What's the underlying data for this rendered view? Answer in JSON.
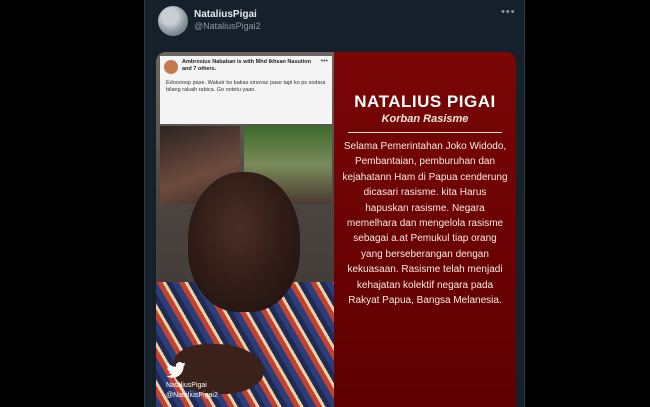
{
  "tweet": {
    "display_name": "NataliusPigai",
    "handle": "@NataliusPigai2",
    "more_icon": "more-dots-icon"
  },
  "media": {
    "fb_post": {
      "author_line": "Ambrosius Nababan is with Mhd Ikhsan Nasution and 7 others.",
      "body": "Edooooop pase. Wakatr ko bakas sinovac pase tapi ko ps sodara bilang rakaih rabica. Go ootetu yaan."
    },
    "watermark": {
      "icon": "twitter-bird-icon",
      "name": "NataliusPigai",
      "handle": "@NataliusPigai2"
    },
    "panel": {
      "title": "NATALIUS PIGAI",
      "subtitle": "Korban Rasisme",
      "body": "Selama Pemerintahan Joko Widodo, Pembantaian, pemburuhan dan kejahatann Ham di Papua cenderung dicasari rasisme. kita Harus hapuskan rasisme. Negara memelhara dan mengelola rasisme sebagai a.at Pemukul tiap orang yang berseberangan dengan kekuasaan. Rasisme telah menjadi kehajatan kolektif negara pada Rakyat Papua, Bangsa Melanesia."
    }
  },
  "colors": {
    "background": "#15202b",
    "panel_red": "#6e0000",
    "text_primary": "#e6ecf0",
    "text_secondary": "#8899a6"
  }
}
